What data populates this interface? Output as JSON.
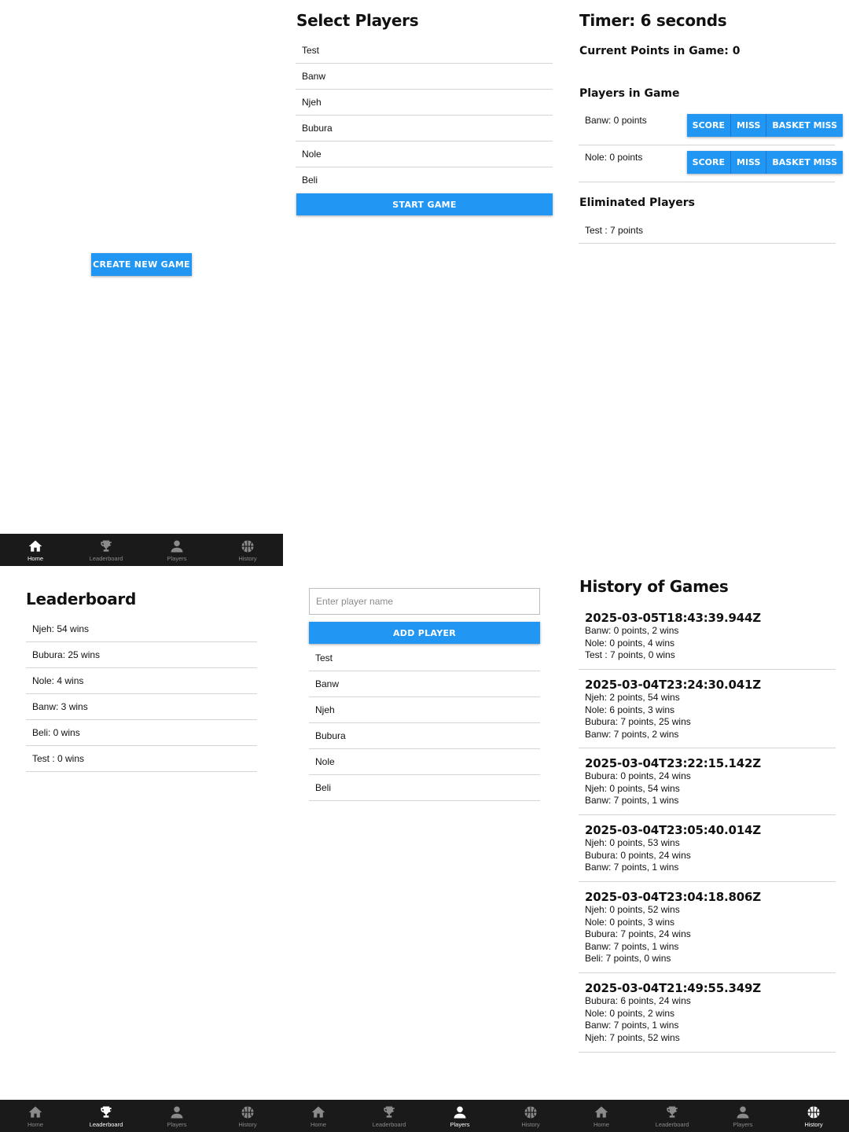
{
  "home": {
    "create_button": "CREATE NEW GAME"
  },
  "select": {
    "title": "Select Players",
    "players": [
      "Test",
      "Banw",
      "Njeh",
      "Bubura",
      "Nole",
      "Beli"
    ],
    "start_button": "START GAME"
  },
  "game": {
    "timer": "Timer: 6 seconds",
    "current_points": "Current Points in Game: 0",
    "players_heading": "Players in Game",
    "players": [
      {
        "label": "Banw: 0 points"
      },
      {
        "label": "Nole: 0 points"
      }
    ],
    "score_label": "SCORE",
    "miss_label": "MISS",
    "basket_miss_label": "BASKET MISS",
    "eliminated_heading": "Eliminated Players",
    "eliminated": [
      "Test : 7 points"
    ]
  },
  "leaderboard": {
    "title": "Leaderboard",
    "entries": [
      "Njeh: 54 wins",
      "Bubura: 25 wins",
      "Nole: 4 wins",
      "Banw: 3 wins",
      "Beli: 0 wins",
      "Test : 0 wins"
    ]
  },
  "players_page": {
    "input_placeholder": "Enter player name",
    "add_button": "ADD PLAYER",
    "players": [
      "Test",
      "Banw",
      "Njeh",
      "Bubura",
      "Nole",
      "Beli"
    ]
  },
  "history": {
    "title": "History of Games",
    "games": [
      {
        "date": "2025-03-05T18:43:39.944Z",
        "lines": [
          "Banw: 0 points, 2 wins",
          "Nole: 0 points, 4 wins",
          "Test : 7 points, 0 wins"
        ]
      },
      {
        "date": "2025-03-04T23:24:30.041Z",
        "lines": [
          "Njeh: 2 points, 54 wins",
          "Nole: 6 points, 3 wins",
          "Bubura: 7 points, 25 wins",
          "Banw: 7 points, 2 wins"
        ]
      },
      {
        "date": "2025-03-04T23:22:15.142Z",
        "lines": [
          "Bubura: 0 points, 24 wins",
          "Njeh: 0 points, 54 wins",
          "Banw: 7 points, 1 wins"
        ]
      },
      {
        "date": "2025-03-04T23:05:40.014Z",
        "lines": [
          "Njeh: 0 points, 53 wins",
          "Bubura: 0 points, 24 wins",
          "Banw: 7 points, 1 wins"
        ]
      },
      {
        "date": "2025-03-04T23:04:18.806Z",
        "lines": [
          "Njeh: 0 points, 52 wins",
          "Nole: 0 points, 3 wins",
          "Bubura: 7 points, 24 wins",
          "Banw: 7 points, 1 wins",
          "Beli: 7 points, 0 wins"
        ]
      },
      {
        "date": "2025-03-04T21:49:55.349Z",
        "lines": [
          "Bubura: 6 points, 24 wins",
          "Nole: 0 points, 2 wins",
          "Banw: 7 points, 1 wins",
          "Njeh: 7 points, 52 wins"
        ]
      }
    ]
  },
  "nav": {
    "items": [
      {
        "label": "Home",
        "icon": "home-icon"
      },
      {
        "label": "Leaderboard",
        "icon": "trophy-icon"
      },
      {
        "label": "Players",
        "icon": "person-icon"
      },
      {
        "label": "History",
        "icon": "basketball-icon"
      }
    ]
  },
  "colors": {
    "accent": "#2196f3",
    "nav_bg": "#1a1a1a",
    "nav_inactive": "#8a8a8a",
    "nav_active": "#ffffff"
  }
}
